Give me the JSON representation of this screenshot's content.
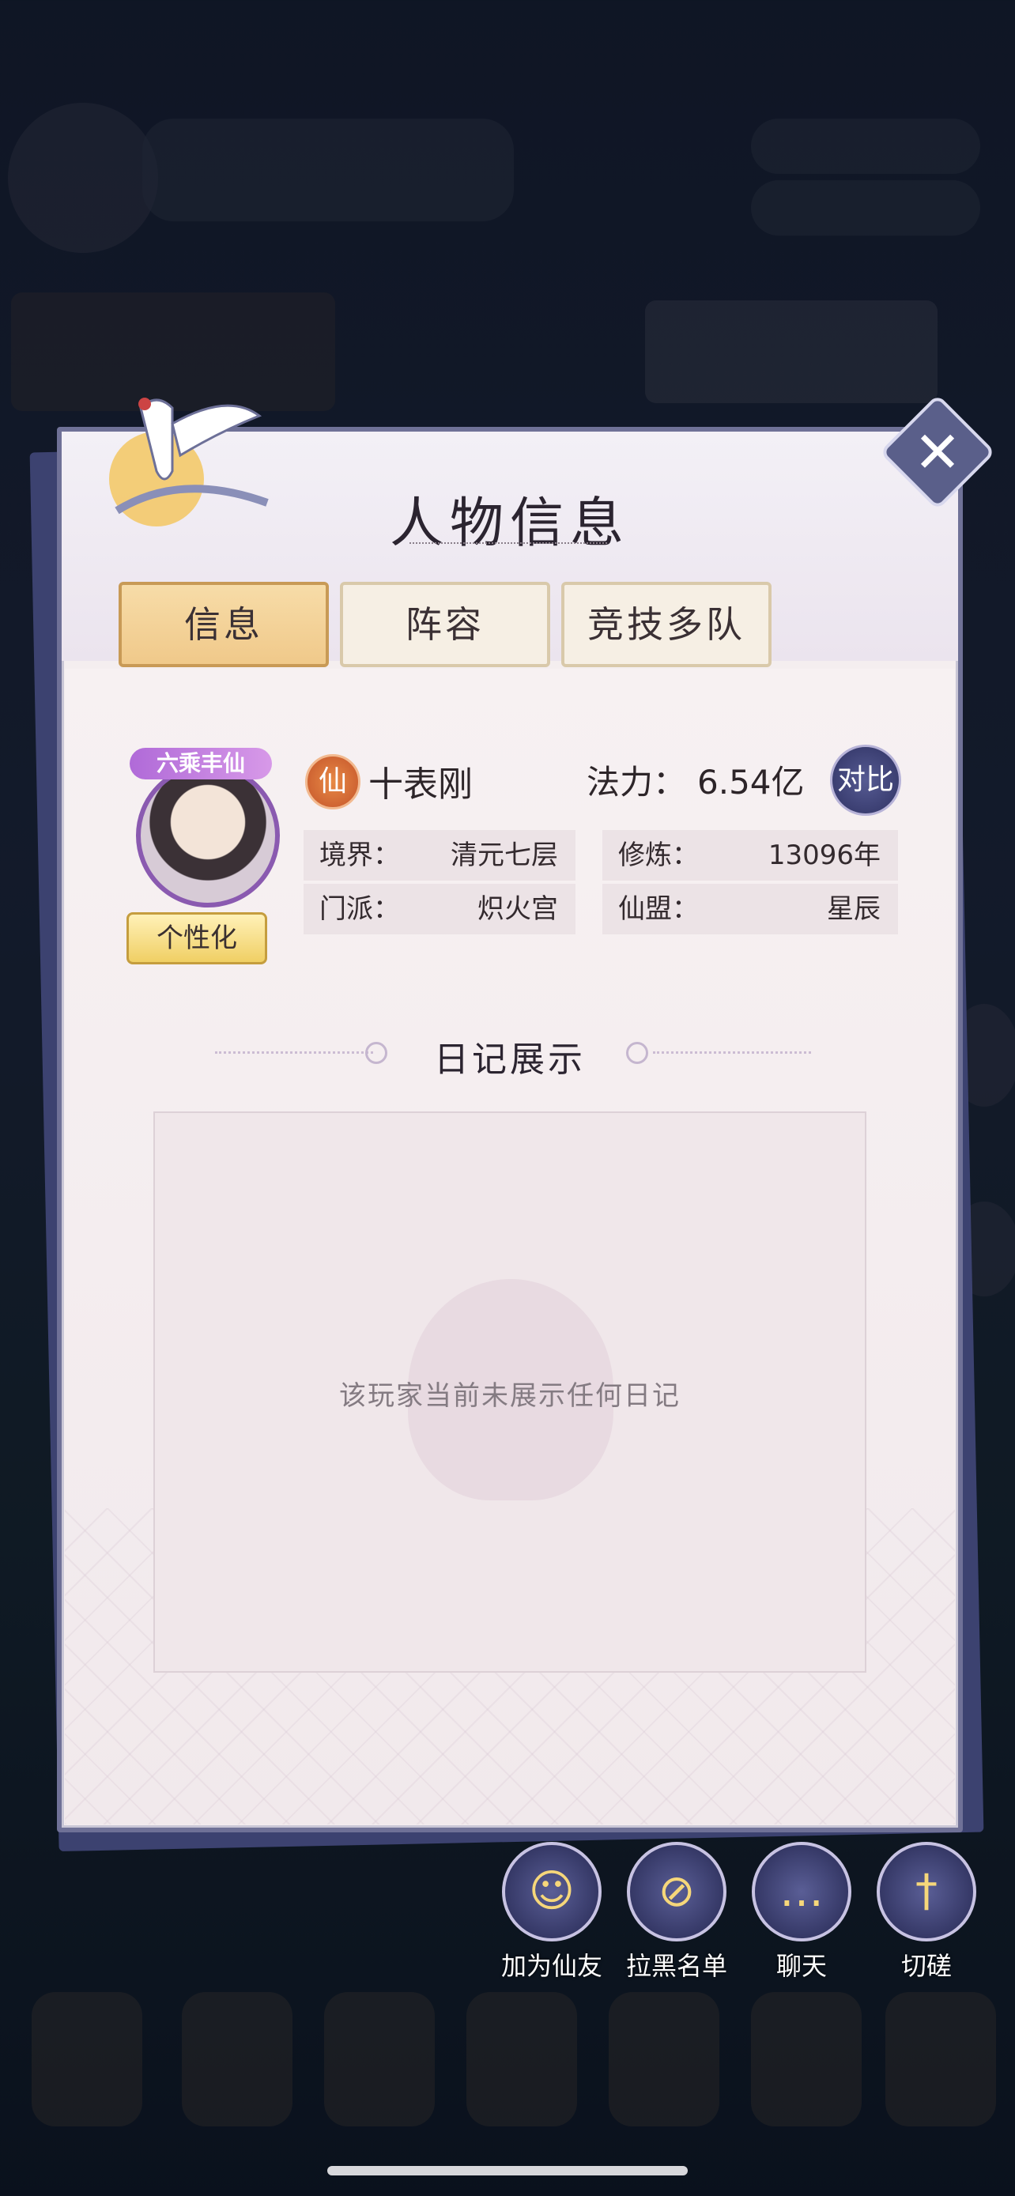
{
  "dialog": {
    "title": "人物信息",
    "close_label": "✕"
  },
  "tabs": [
    {
      "label": "信息",
      "active": true
    },
    {
      "label": "阵容",
      "active": false
    },
    {
      "label": "竞技多队",
      "active": false
    }
  ],
  "profile": {
    "avatar_badge": "六乘丰仙",
    "customize_label": "个性化",
    "rank_icon_label": "仙",
    "name": "十表刚",
    "power_label": "法力：",
    "power_value": "6.54亿",
    "compare_label": "对比"
  },
  "stats": [
    {
      "key": "境界：",
      "value": "清元七层"
    },
    {
      "key": "修炼：",
      "value": "13096年"
    },
    {
      "key": "门派：",
      "value": "炽火宫"
    },
    {
      "key": "仙盟：",
      "value": "星辰"
    }
  ],
  "diary": {
    "section_title": "日记展示",
    "empty_text": "该玩家当前未展示任何日记"
  },
  "actions": [
    {
      "label": "加为仙友",
      "icon": "add-friend-icon"
    },
    {
      "label": "拉黑名单",
      "icon": "block-user-icon"
    },
    {
      "label": "聊天",
      "icon": "chat-icon"
    },
    {
      "label": "切磋",
      "icon": "sword-icon"
    }
  ],
  "colors": {
    "panel_border": "#6f7197",
    "active_tab": "#f0c98a",
    "button_circle": "#353866",
    "accent_gold": "#f6d77a"
  }
}
